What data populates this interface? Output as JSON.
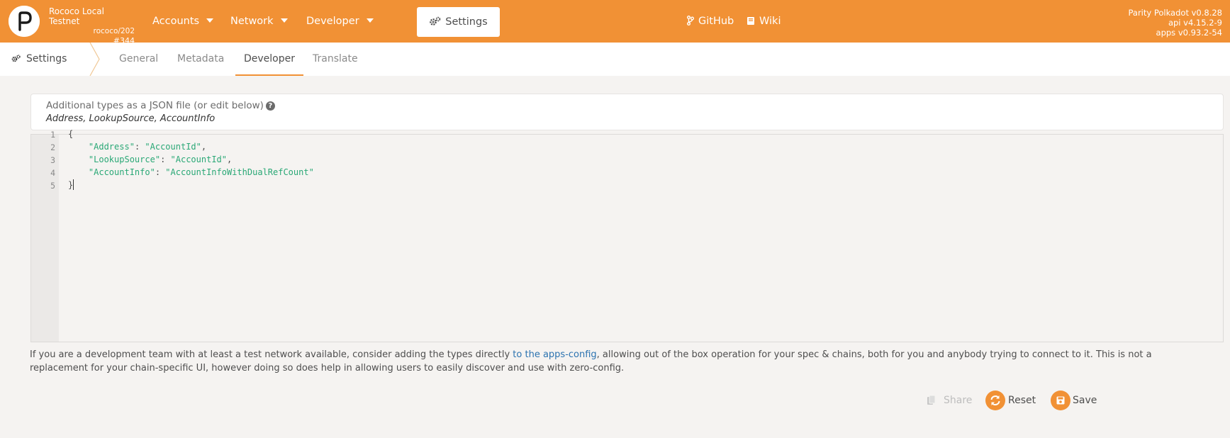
{
  "topbar": {
    "chain_name": "Rococo Local Testnet",
    "chain_spec": "rococo/202",
    "chain_block": "#344",
    "nav": {
      "accounts": "Accounts",
      "network": "Network",
      "developer": "Developer",
      "settings": "Settings"
    },
    "links": {
      "github": "GitHub",
      "wiki": "Wiki"
    },
    "versions": {
      "node": "Parity Polkadot v0.8.28",
      "api": "api v4.15.2-9",
      "apps": "apps v0.93.2-54"
    }
  },
  "subbar": {
    "title": "Settings",
    "tabs": {
      "general": "General",
      "metadata": "Metadata",
      "developer": "Developer",
      "translate": "Translate"
    },
    "active_tab": "Developer"
  },
  "types": {
    "label": "Additional types as a JSON file (or edit below)",
    "help_glyph": "?",
    "value": "Address, LookupSource, AccountInfo"
  },
  "editor": {
    "line_numbers": [
      "1",
      "2",
      "3",
      "4",
      "5"
    ],
    "open_brace": "{",
    "close_brace": "}",
    "entries": [
      {
        "key": "\"Address\"",
        "value": "\"AccountId\""
      },
      {
        "key": "\"LookupSource\"",
        "value": "\"AccountId\""
      },
      {
        "key": "\"AccountInfo\"",
        "value": "\"AccountInfoWithDualRefCount\""
      }
    ]
  },
  "description": {
    "before": "If you are a development team with at least a test network available, consider adding the types directly ",
    "link": "to the apps-config",
    "after": ", allowing out of the box operation for your spec & chains, both for you and anybody trying to connect to it. This is not a replacement for your chain-specific UI, however doing so does help in allowing users to easily discover and use with zero-config."
  },
  "buttons": {
    "share": "Share",
    "reset": "Reset",
    "save": "Save"
  },
  "colors": {
    "accent": "#f19135",
    "link": "#2c73b0",
    "json_string": "#2aa876",
    "background": "#f5f3f1"
  }
}
